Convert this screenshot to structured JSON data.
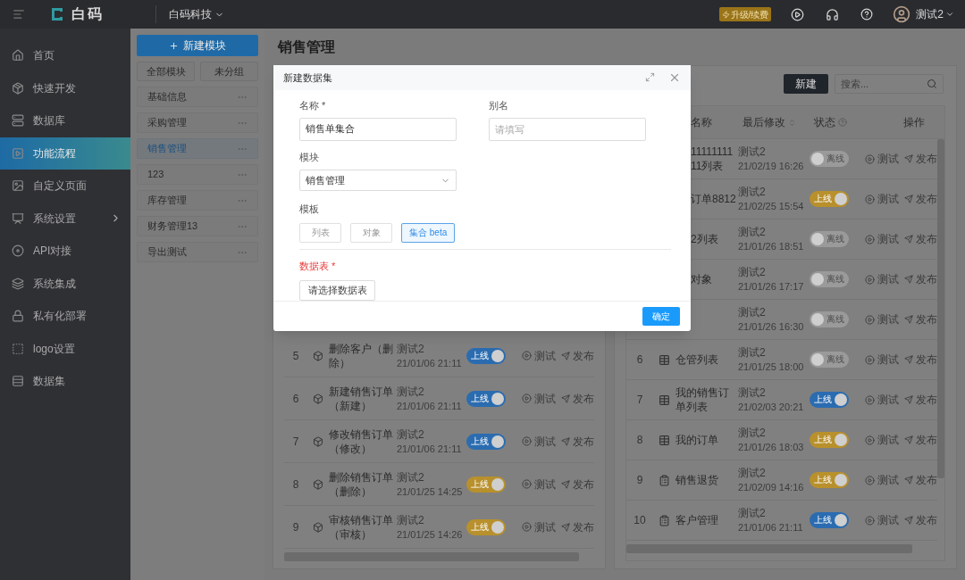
{
  "topbar": {
    "logo": "白码",
    "company": "白码科技",
    "upgrade": "升级/续费",
    "user": "测试2"
  },
  "sidebar": {
    "items": [
      {
        "label": "首页",
        "selected": false,
        "has_children": false
      },
      {
        "label": "快速开发",
        "selected": false,
        "has_children": false
      },
      {
        "label": "数据库",
        "selected": false,
        "has_children": false
      },
      {
        "label": "功能流程",
        "selected": true,
        "has_children": false
      },
      {
        "label": "自定义页面",
        "selected": false,
        "has_children": false
      },
      {
        "label": "系统设置",
        "selected": false,
        "has_children": true
      },
      {
        "label": "API对接",
        "selected": false,
        "has_children": false
      },
      {
        "label": "系统集成",
        "selected": false,
        "has_children": false
      },
      {
        "label": "私有化部署",
        "selected": false,
        "has_children": false
      },
      {
        "label": "logo设置",
        "selected": false,
        "has_children": false
      },
      {
        "label": "数据集",
        "selected": false,
        "has_children": false
      }
    ]
  },
  "modules": {
    "new_button": "新建模块",
    "filters": [
      "全部模块",
      "未分组"
    ],
    "items": [
      {
        "label": "基础信息",
        "selected": false
      },
      {
        "label": "采购管理",
        "selected": false
      },
      {
        "label": "销售管理",
        "selected": true
      },
      {
        "label": "123",
        "selected": false
      },
      {
        "label": "库存管理",
        "selected": false
      },
      {
        "label": "财务管理13",
        "selected": false
      },
      {
        "label": "导出测试",
        "selected": false
      }
    ]
  },
  "page_title": "销售管理",
  "left_table": {
    "rows": [
      {
        "index": "5",
        "name": "删除客户（删除）",
        "user": "测试2",
        "time": "21/01/06 21:11",
        "status": {
          "on": true,
          "color": "#2b6cb0",
          "label": "上线"
        },
        "actions": [
          "测试",
          "发布"
        ]
      },
      {
        "index": "6",
        "name": "新建销售订单（新建）",
        "user": "测试2",
        "time": "21/01/06 21:11",
        "status": {
          "on": true,
          "color": "#2b6cb0",
          "label": "上线"
        },
        "actions": [
          "测试",
          "发布"
        ]
      },
      {
        "index": "7",
        "name": "修改销售订单（修改）",
        "user": "测试2",
        "time": "21/01/06 21:11",
        "status": {
          "on": true,
          "color": "#2b6cb0",
          "label": "上线"
        },
        "actions": [
          "测试",
          "发布"
        ]
      },
      {
        "index": "8",
        "name": "删除销售订单（删除）",
        "user": "测试2",
        "time": "21/01/25 14:25",
        "status": {
          "on": true,
          "color": "#b8902c",
          "label": "上线"
        },
        "actions": [
          "测试",
          "发布"
        ]
      },
      {
        "index": "9",
        "name": "审核销售订单（审核）",
        "user": "测试2",
        "time": "21/01/25 14:26",
        "status": {
          "on": true,
          "color": "#b8902c",
          "label": "上线"
        },
        "actions": [
          "测试",
          "发布"
        ]
      }
    ]
  },
  "right_table": {
    "new_button": "新建",
    "search_placeholder": "搜索...",
    "columns": [
      "名称",
      "最后修改",
      "状态",
      "操作"
    ],
    "rows": [
      {
        "kind": "partial",
        "name_lines": [
          "11111111",
          "11列表"
        ],
        "user": "测试2",
        "time": "21/02/19 16:26",
        "status": {
          "on": false,
          "label": "离线"
        },
        "actions": [
          "测试",
          "发布"
        ]
      },
      {
        "kind": "partial",
        "name_lines": [
          "订单8812"
        ],
        "user": "测试2",
        "time": "21/02/25 15:54",
        "status": {
          "on": true,
          "color": "#b8902c",
          "label": "上线"
        },
        "actions": [
          "测试",
          "发布"
        ]
      },
      {
        "kind": "partial",
        "name_lines": [
          "2列表"
        ],
        "user": "测试2",
        "time": "21/01/26 18:51",
        "status": {
          "on": false,
          "label": "离线"
        },
        "actions": [
          "测试",
          "发布"
        ]
      },
      {
        "kind": "partial",
        "name_lines": [
          "对象"
        ],
        "user": "测试2",
        "time": "21/01/26 17:17",
        "status": {
          "on": false,
          "label": "离线"
        },
        "actions": [
          "测试",
          "发布"
        ]
      },
      {
        "kind": "partial",
        "user": "测试2",
        "time": "21/01/26 16:30",
        "status": {
          "on": false,
          "label": "离线"
        },
        "actions": [
          "测试",
          "发布"
        ]
      },
      {
        "kind": "table",
        "index": "6",
        "name": "仓管列表",
        "user": "测试2",
        "time": "21/01/25 18:00",
        "status": {
          "on": false,
          "label": "离线"
        },
        "actions": [
          "测试",
          "发布"
        ]
      },
      {
        "kind": "table",
        "index": "7",
        "name": "我的销售订单列表",
        "user": "测试2",
        "time": "21/02/03 20:21",
        "status": {
          "on": true,
          "color": "#2b6cb0",
          "label": "上线"
        },
        "actions": [
          "测试",
          "发布"
        ]
      },
      {
        "kind": "table",
        "index": "8",
        "name": "我的订单",
        "user": "测试2",
        "time": "21/01/26 18:03",
        "status": {
          "on": true,
          "color": "#b8902c",
          "label": "上线"
        },
        "actions": [
          "测试",
          "发布"
        ]
      },
      {
        "kind": "form",
        "index": "9",
        "name": "销售退货",
        "user": "测试2",
        "time": "21/02/09 14:16",
        "status": {
          "on": true,
          "color": "#b8902c",
          "label": "上线"
        },
        "actions": [
          "测试",
          "发布"
        ]
      },
      {
        "kind": "form",
        "index": "10",
        "name": "客户管理",
        "user": "测试2",
        "time": "21/01/06 21:11",
        "status": {
          "on": true,
          "color": "#2b6cb0",
          "label": "上线"
        },
        "actions": [
          "测试",
          "发布"
        ]
      }
    ]
  },
  "dialog": {
    "title": "新建数据集",
    "fields": [
      {
        "label": "名称",
        "mark": "*",
        "value": "销售单集合"
      },
      {
        "label": "别名",
        "placeholder": "请填写"
      }
    ],
    "module": {
      "label": "模块",
      "value": "销售管理"
    },
    "template": {
      "label": "模板",
      "options": [
        {
          "label": "列表",
          "selected": false
        },
        {
          "label": "对象",
          "selected": false
        },
        {
          "label": "集合 beta",
          "selected": true
        }
      ]
    },
    "table": {
      "label": "数据表",
      "mark": "*",
      "error": true,
      "button": "请选择数据表"
    },
    "confirm": "确定"
  }
}
